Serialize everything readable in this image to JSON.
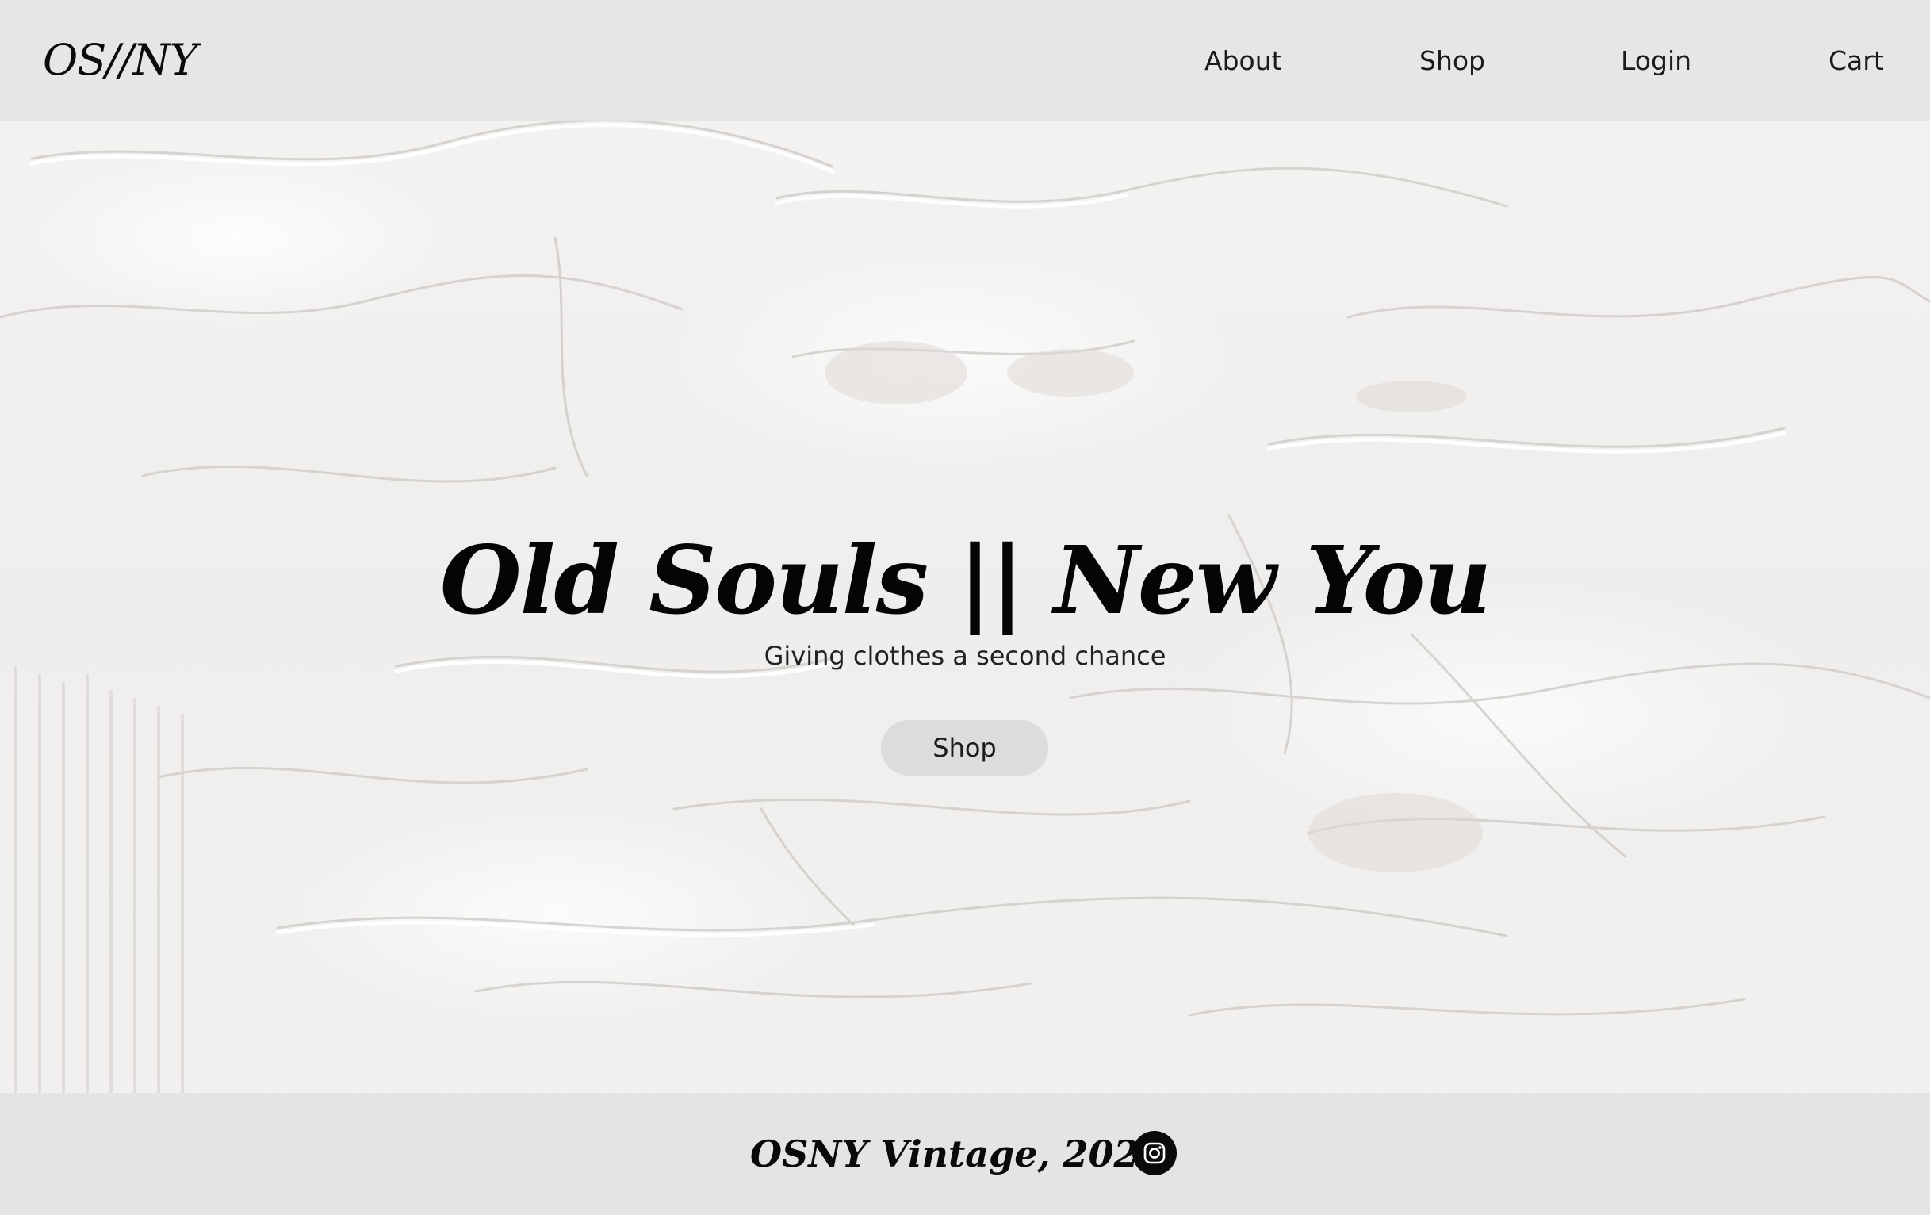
{
  "header": {
    "logo": "OS//NY",
    "nav": {
      "about": "About",
      "shop": "Shop",
      "login": "Login",
      "cart": "Cart"
    }
  },
  "hero": {
    "title": "Old Souls || New You",
    "subtitle": "Giving clothes a second chance",
    "button": "Shop"
  },
  "footer": {
    "text": "OSNY Vintage, 2020",
    "social_icon": "instagram-icon"
  },
  "colors": {
    "header_bg": "#e4e4e5",
    "button_bg": "#dcdcdc",
    "text": "#111111",
    "icon_bg": "#0a0a0a"
  }
}
